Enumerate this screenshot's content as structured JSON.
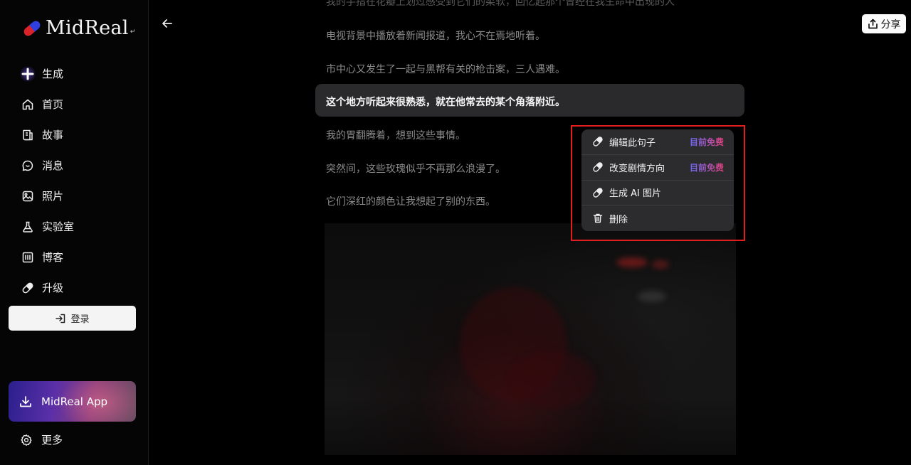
{
  "sidebar": {
    "logo_text": "MidReal",
    "logo_mark": "↵",
    "nav": [
      {
        "label": "生成",
        "icon": "plus-icon"
      },
      {
        "label": "首页",
        "icon": "home-icon"
      },
      {
        "label": "故事",
        "icon": "story-icon"
      },
      {
        "label": "消息",
        "icon": "message-icon"
      },
      {
        "label": "照片",
        "icon": "photo-icon"
      },
      {
        "label": "实验室",
        "icon": "flask-icon"
      },
      {
        "label": "博客",
        "icon": "blog-icon"
      },
      {
        "label": "升级",
        "icon": "pill-icon"
      }
    ],
    "login_label": "登录",
    "app_button_label": "MidReal App",
    "more_label": "更多"
  },
  "header": {
    "share_label": "分享"
  },
  "story": {
    "cut_line": "我的手指在花瓣上划过感受到它们的柔软，回忆起那个曾经在我生命中出现的人",
    "lines": [
      "电视背景中播放着新闻报道，我心不在焉地听着。",
      "市中心又发生了一起与黑帮有关的枪击案，三人遇难。",
      "这个地方听起来很熟悉，就在他常去的某个角落附近。",
      "我的胃翻腾着，想到这些事情。",
      "突然间，这些玫瑰似乎不再那么浪漫了。",
      "它们深红的颜色让我想起了别的东西。"
    ]
  },
  "context_menu": {
    "items": [
      {
        "label": "编辑此句子",
        "badge": "目前免费",
        "icon": "pill-icon"
      },
      {
        "label": "改变剧情方向",
        "badge": "目前免费",
        "icon": "pill-icon"
      },
      {
        "label": "生成 AI 图片",
        "badge": "",
        "icon": "pill-icon"
      },
      {
        "label": "删除",
        "badge": "",
        "icon": "trash-icon"
      }
    ]
  },
  "colors": {
    "accent_red": "#e21d1d",
    "badge_gradient_start": "#6c6cff",
    "badge_gradient_end": "#e0407a"
  }
}
